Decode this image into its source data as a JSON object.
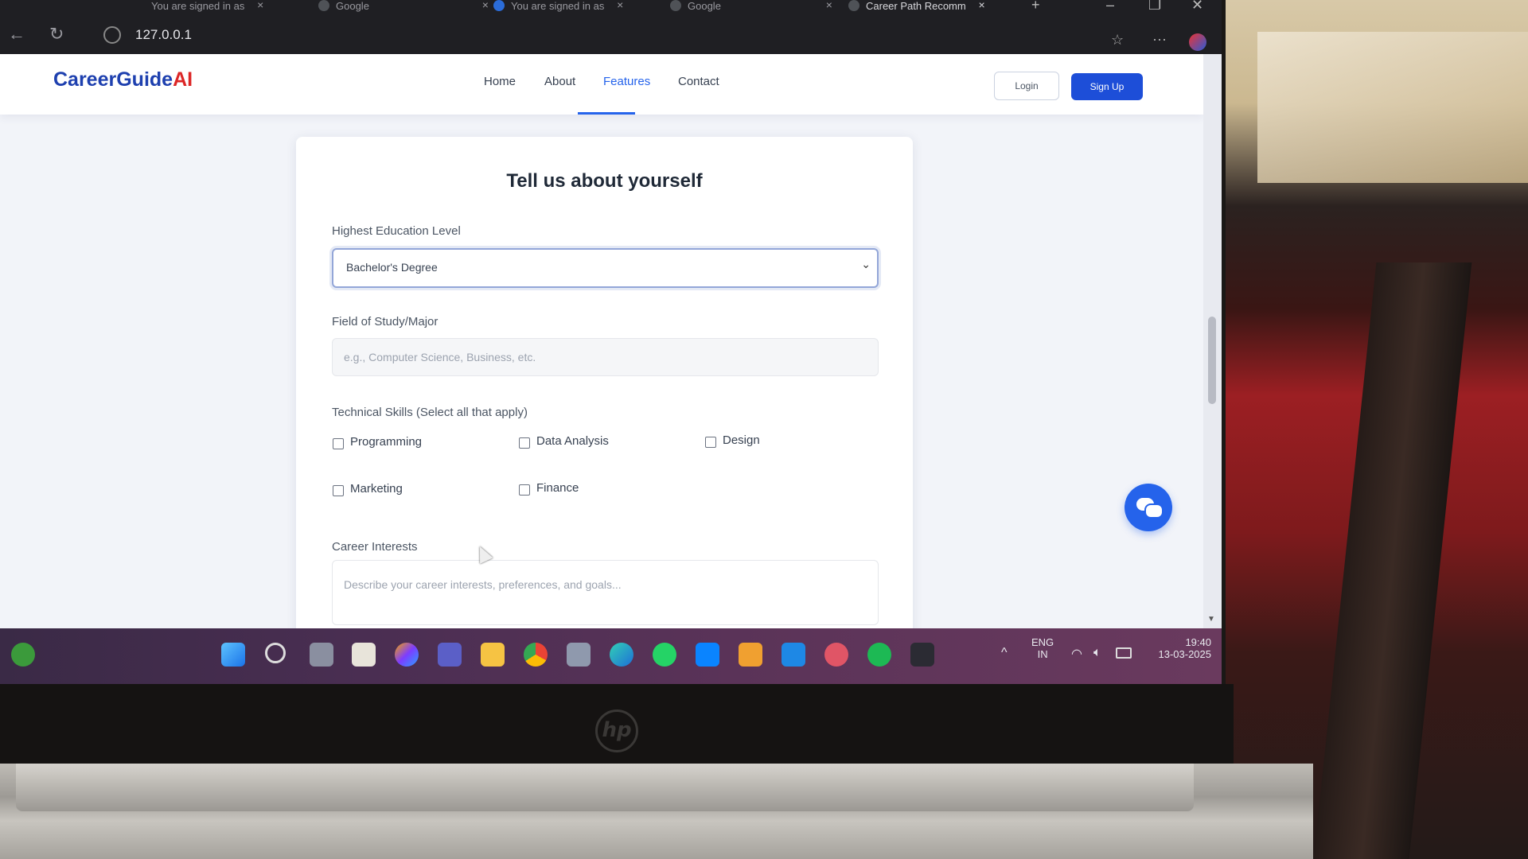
{
  "browser": {
    "tabs": [
      {
        "title": "You are signed in as"
      },
      {
        "title": "Google"
      },
      {
        "title": "You are signed in as"
      },
      {
        "title": "Google"
      },
      {
        "title": "Career Path Recomm"
      }
    ],
    "new_tab": "+",
    "url": "127.0.0.1"
  },
  "site": {
    "brand_main": "CareerGuide",
    "brand_ai": "AI",
    "nav": [
      "Home",
      "About",
      "Features",
      "Contact"
    ],
    "active_nav": "Features",
    "login_label": "Login",
    "signup_label": "Sign Up"
  },
  "form": {
    "title": "Tell us about yourself",
    "education_label": "Highest Education Level",
    "education_value": "Bachelor's Degree",
    "field_label": "Field of Study/Major",
    "field_placeholder": "e.g., Computer Science, Business, etc.",
    "skills_label": "Technical Skills (Select all that apply)",
    "skills": [
      {
        "label": "Programming",
        "checked": false
      },
      {
        "label": "Data Analysis",
        "checked": false
      },
      {
        "label": "Design",
        "checked": false
      },
      {
        "label": "Marketing",
        "checked": false
      },
      {
        "label": "Finance",
        "checked": false
      }
    ],
    "interests_label": "Career Interests",
    "interests_placeholder": "Describe your career interests, preferences, and goals..."
  },
  "taskbar": {
    "tray_lang": "ENG",
    "tray_region": "IN",
    "time": "19:40",
    "date": "13-03-2025"
  },
  "colors": {
    "brand_blue": "#1e40af",
    "brand_red": "#dc2626",
    "accent": "#2563eb"
  }
}
